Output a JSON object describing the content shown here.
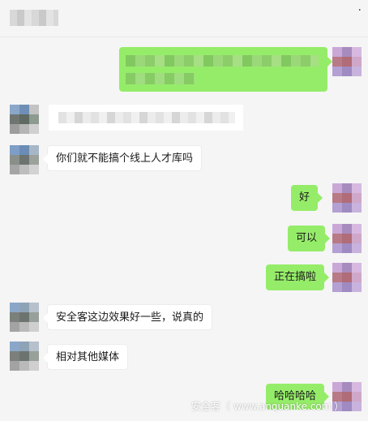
{
  "header": {
    "more_icon": "more-dots-icon",
    "more_glyph": "·"
  },
  "messages": {
    "m3": "你们就不能搞个线上人才库吗",
    "m4": "好",
    "m5": "可以",
    "m6": "正在搞啦",
    "m7": "安全客这边效果好一些，说真的",
    "m8": "相对其他媒体",
    "m9": "哈哈哈哈"
  },
  "watermark": "安全客（ www.anquanke.com ）",
  "colors": {
    "outgoing_bubble": "#95ec69",
    "incoming_bubble": "#ffffff",
    "background": "#f5f5f5"
  }
}
